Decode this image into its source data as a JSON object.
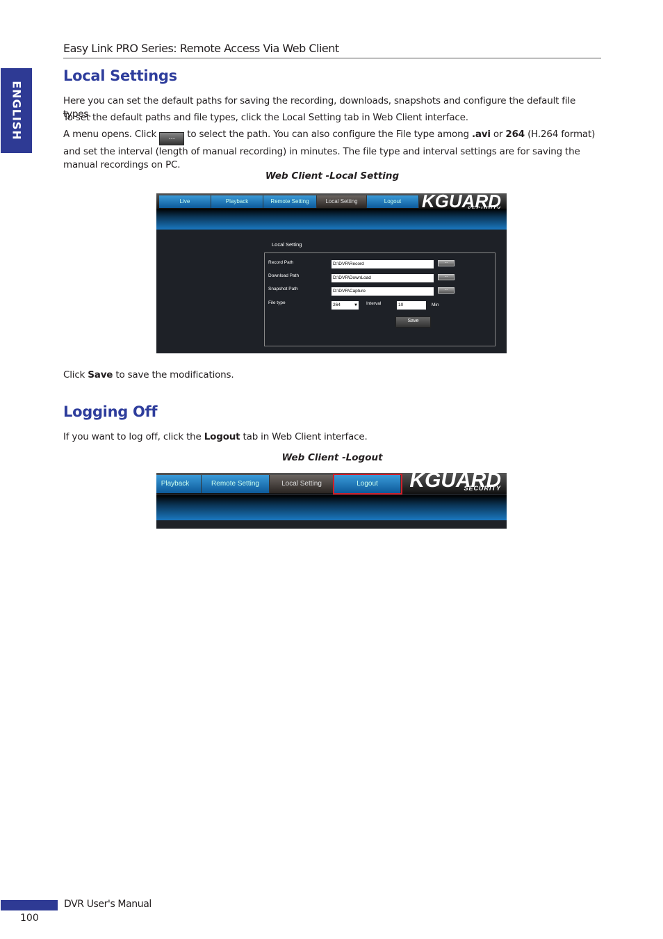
{
  "header": {
    "title": "Easy Link PRO Series: Remote Access Via Web Client"
  },
  "side_tab": {
    "label": "ENGLISH"
  },
  "local_settings": {
    "heading": "Local Settings",
    "p1": "Here you can set the default paths for saving the recording, downloads, snapshots  and configure the default file types.",
    "p2": "To set the default paths and file types, click the Local Setting tab in Web Client interface.",
    "p3a": "A menu opens. Click",
    "p3_button": "...",
    "p3b": "to select the path. You can also configure the File type among",
    "p3_avi": ".avi",
    "p3c": "or",
    "p3_264": "264",
    "p3d": "(H.264 format) and set the interval (length of manual recording) in minutes. The file type and interval settings are for saving the manual recordings on PC.",
    "caption": "Web Client -Local Setting",
    "screenshot": {
      "tabs": [
        "Live",
        "Playback",
        "Remote Setting",
        "Local Setting",
        "Logout"
      ],
      "active_tab": "Local Setting",
      "logo_main": "KGUARD",
      "logo_sub": "SECURITY",
      "panel_title": "Local Setting",
      "record_label": "Record Path",
      "record_value": "D:\\DVR\\Record",
      "download_label": "Download Path",
      "download_value": "D:\\DVR\\DownLoad",
      "snapshot_label": "Snapshot Path",
      "snapshot_value": "D:\\DVR\\Capture",
      "browse": "...",
      "filetype_label": "File type",
      "filetype_value": "264",
      "interval_label": "Interval",
      "interval_value": "10",
      "interval_unit": "Min",
      "save": "Save"
    },
    "after_a": "Click",
    "after_bold": "Save",
    "after_b": "to save the modifications."
  },
  "logging_off": {
    "heading": "Logging Off",
    "p_a": "If you want to log off, click the",
    "p_bold": "Logout",
    "p_b": "tab in Web Client interface.",
    "caption": "Web Client -Logout",
    "screenshot": {
      "tabs": [
        "Playback",
        "Remote Setting",
        "Local Setting",
        "Logout"
      ],
      "highlighted_tab": "Logout",
      "highlight_color": "#d0202a"
    }
  },
  "footer": {
    "title": "DVR User's Manual",
    "page": "100"
  }
}
